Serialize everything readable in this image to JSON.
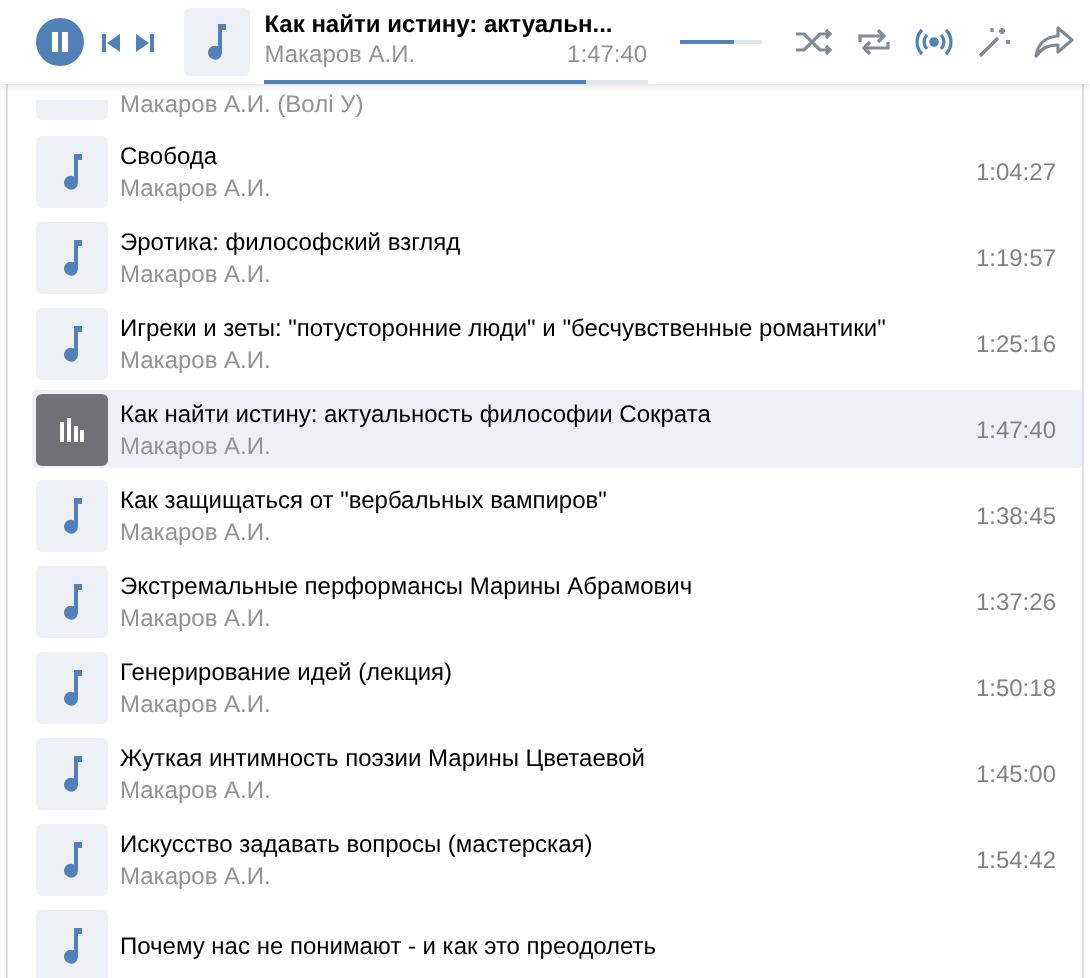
{
  "player": {
    "playing": true,
    "title": "Как найти истину: актуальн...",
    "artist": "Макаров А.И.",
    "time": "1:47:40",
    "progress": {
      "level": 0.84
    },
    "volume": {
      "level": 0.67
    },
    "controls": [
      {
        "kind": "shuffle",
        "on": false
      },
      {
        "kind": "repeat",
        "on": false
      },
      {
        "kind": "broadcast",
        "on": true
      },
      {
        "kind": "recommend"
      },
      {
        "kind": "share"
      }
    ]
  },
  "tracks": [
    {
      "artist": "Макаров А.И. (Волі У)",
      "selected": false
    },
    {
      "title": "Свобода",
      "artist": "Макаров А.И.",
      "duration": "1:04:27",
      "selected": false
    },
    {
      "title": "Эротика: философский взгляд",
      "artist": "Макаров А.И.",
      "duration": "1:19:57",
      "selected": false
    },
    {
      "title": "Игреки и зеты: \"потусторонние люди\" и \"бесчувственные романтики\"",
      "artist": "Макаров А.И.",
      "duration": "1:25:16",
      "selected": false
    },
    {
      "title": "Как найти истину: актуальность философии Сократа",
      "artist": "Макаров А.И.",
      "duration": "1:47:40",
      "selected": true
    },
    {
      "title": "Как защищаться от \"вербальных вампиров\"",
      "artist": "Макаров А.И.",
      "duration": "1:38:45",
      "selected": false
    },
    {
      "title": "Экстремальные перформансы Марины Абрамович",
      "artist": "Макаров А.И.",
      "duration": "1:37:26",
      "selected": false
    },
    {
      "title": "Генерирование идей (лекция)",
      "artist": "Макаров А.И.",
      "duration": "1:50:18",
      "selected": false
    },
    {
      "title": "Жуткая интимность поэзии Марины Цветаевой",
      "artist": "Макаров А.И.",
      "duration": "1:45:00",
      "selected": false
    },
    {
      "title": "Искусство задавать вопросы (мастерская)",
      "artist": "Макаров А.И.",
      "duration": "1:54:42",
      "selected": false
    },
    {
      "title": "Почему нас не понимают - и как это преодолеть",
      "selected": false
    }
  ]
}
